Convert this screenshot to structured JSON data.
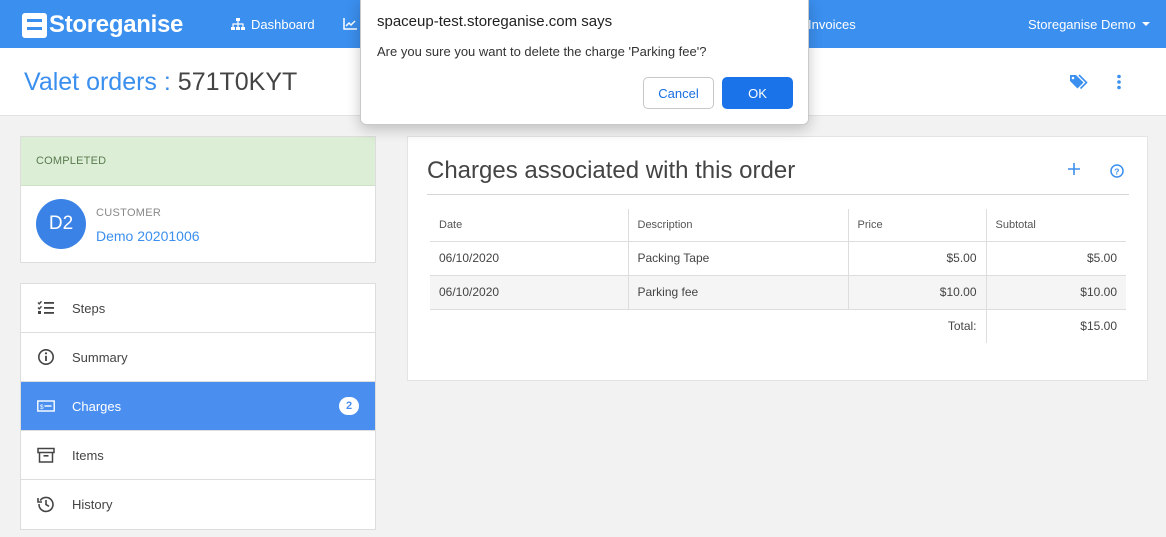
{
  "nav": {
    "brand": "Storeganise",
    "dashboard": "Dashboard",
    "invoices": "Invoices",
    "user": "Storeganise Demo"
  },
  "header": {
    "title": "Valet orders",
    "separator": ":",
    "order_code": "571T0KYT"
  },
  "order": {
    "status": "COMPLETED",
    "customer_initials": "D2",
    "customer_label": "CUSTOMER",
    "customer_name": "Demo 20201006"
  },
  "menu": {
    "items": [
      {
        "label": "Steps",
        "icon": "checklist-icon"
      },
      {
        "label": "Summary",
        "icon": "info-icon"
      },
      {
        "label": "Charges",
        "icon": "money-icon",
        "badge": "2",
        "active": true
      },
      {
        "label": "Items",
        "icon": "archive-box-icon"
      },
      {
        "label": "History",
        "icon": "history-icon"
      }
    ]
  },
  "charges": {
    "title": "Charges associated with this order",
    "columns": [
      "Date",
      "Description",
      "Price",
      "Subtotal"
    ],
    "rows": [
      {
        "date": "06/10/2020",
        "description": "Packing Tape",
        "price": "$5.00",
        "subtotal": "$5.00"
      },
      {
        "date": "06/10/2020",
        "description": "Parking fee",
        "price": "$10.00",
        "subtotal": "$10.00"
      }
    ],
    "total_label": "Total:",
    "total_value": "$15.00"
  },
  "dialog": {
    "title": "spaceup-test.storeganise.com says",
    "message": "Are you sure you want to delete the charge 'Parking fee'?",
    "cancel": "Cancel",
    "ok": "OK"
  },
  "colors": {
    "primary": "#3b8fee",
    "status_bg": "#dcefd6",
    "active_menu": "#4a8ff0",
    "dialog_ok": "#1a73e8"
  }
}
